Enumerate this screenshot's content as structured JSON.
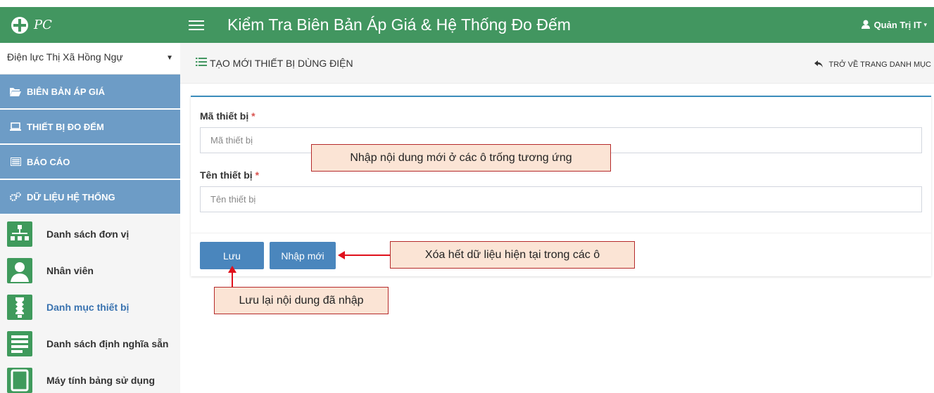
{
  "brand": {
    "logo_text": "PC"
  },
  "header": {
    "title": "Kiểm Tra Biên Bản Áp Giá & Hệ Thống Đo Đếm",
    "user_label": "Quản Trị IT"
  },
  "sidebar": {
    "unit_selected": "Điện lực Thị Xã Hồng Ngự",
    "groups": [
      {
        "label": "BIÊN BẢN ÁP GIÁ",
        "icon": "folder-open-icon"
      },
      {
        "label": "THIẾT BỊ ĐO ĐẾM",
        "icon": "laptop-icon"
      },
      {
        "label": "BÁO CÁO",
        "icon": "list-alt-icon"
      },
      {
        "label": "DỮ LIỆU HỆ THỐNG",
        "icon": "gears-icon"
      }
    ],
    "items": [
      {
        "label": "Danh sách đơn vị",
        "icon": "org-chart-icon"
      },
      {
        "label": "Nhân viên",
        "icon": "user-icon"
      },
      {
        "label": "Danh mục thiết bị",
        "icon": "lightbulb-icon",
        "active": true
      },
      {
        "label": "Danh sách định nghĩa sẵn",
        "icon": "document-list-icon"
      },
      {
        "label": "Máy tính bảng sử dụng",
        "icon": "tablet-icon"
      }
    ]
  },
  "page": {
    "title": "TẠO MỚI THIẾT BỊ DÙNG ĐIỆN",
    "back_label": "TRỞ VỀ TRANG DANH MỤC"
  },
  "form": {
    "code_label": "Mã thiết bị",
    "code_placeholder": "Mã thiết bị",
    "name_label": "Tên thiết bị",
    "name_placeholder": "Tên thiết bị",
    "required_mark": "*",
    "save_label": "Lưu",
    "reset_label": "Nhập mới"
  },
  "callouts": {
    "input_hint": "Nhập nội dung mới ở các ô trống tương ứng",
    "reset_hint": "Xóa hết dữ liệu hiện tại trong các ô",
    "save_hint": "Lưu lại nội dung đã nhập"
  },
  "colors": {
    "green": "#429660",
    "menu_blue": "#6d9cc6",
    "button_blue": "#4a86bd",
    "callout_bg": "#fbe4d5",
    "arrow_red": "#e0111c"
  }
}
